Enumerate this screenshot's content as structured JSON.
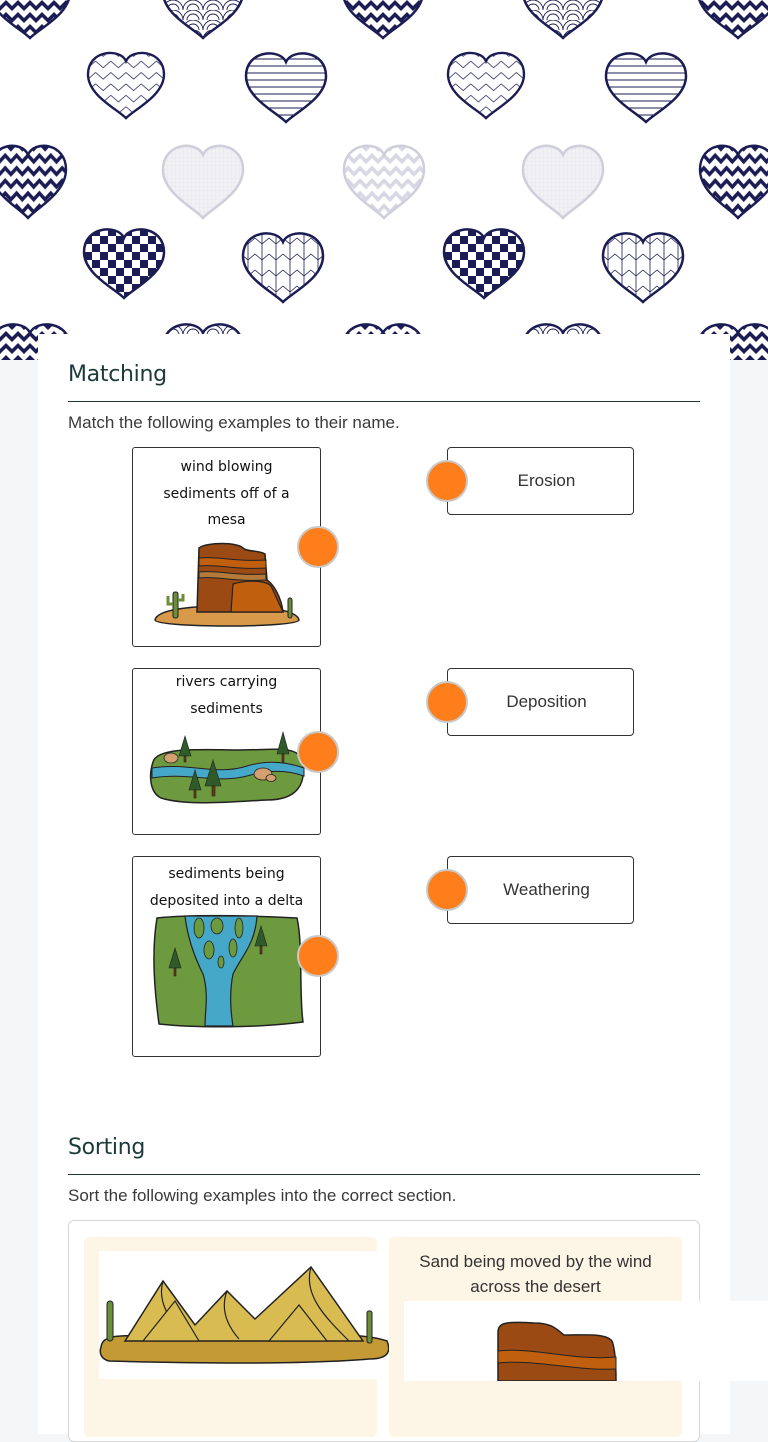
{
  "banner": {
    "pattern": "hearts-pattern",
    "colors": {
      "navy": "#1b1c54",
      "light": "#d7d8e3"
    }
  },
  "matching": {
    "title": "Matching",
    "instructions": "Match the following examples to their name.",
    "prompts": [
      {
        "text": "wind blowing sediments off of a mesa",
        "image": "mesa-illustration"
      },
      {
        "text": "rivers carrying sediments",
        "image": "river-illustration"
      },
      {
        "text": "sediments being deposited into a delta",
        "image": "delta-illustration"
      }
    ],
    "answers": [
      {
        "label": "Erosion"
      },
      {
        "label": "Deposition"
      },
      {
        "label": "Weathering"
      }
    ],
    "connector_color": "#fd7e1a"
  },
  "sorting": {
    "title": "Sorting",
    "instructions": "Sort the following examples into the correct section.",
    "items": [
      {
        "text": "",
        "image": "sand-dunes-illustration"
      },
      {
        "text": "Sand being moved by the wind across the desert",
        "image": "mesa-illustration"
      }
    ]
  }
}
